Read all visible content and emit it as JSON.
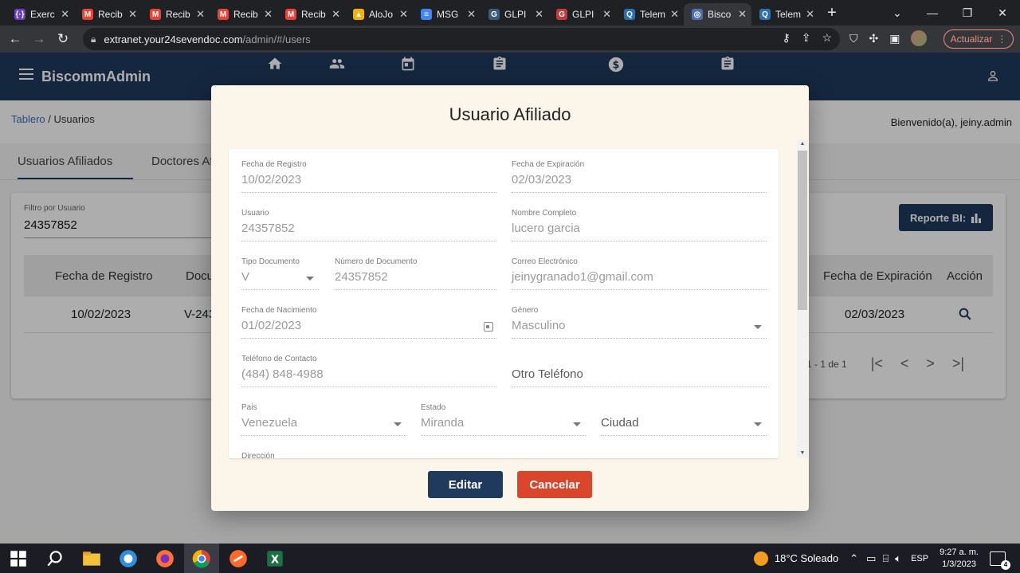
{
  "browser": {
    "tabs": [
      {
        "label": "Exerc",
        "icon": "dev-icon",
        "color": "#6a3cc4",
        "glyph": "{·}"
      },
      {
        "label": "Recib",
        "icon": "gmail-icon",
        "color": "#ea4335",
        "glyph": "M"
      },
      {
        "label": "Recib",
        "icon": "gmail-icon",
        "color": "#ea4335",
        "glyph": "M"
      },
      {
        "label": "Recib",
        "icon": "gmail-icon",
        "color": "#ea4335",
        "glyph": "M"
      },
      {
        "label": "Recib",
        "icon": "gmail-icon",
        "color": "#ea4335",
        "glyph": "M"
      },
      {
        "label": "AloJo",
        "icon": "drive-icon",
        "color": "#f4b400",
        "glyph": "▲"
      },
      {
        "label": "MSG",
        "icon": "docs-icon",
        "color": "#4285f4",
        "glyph": "≡"
      },
      {
        "label": "GLPI",
        "icon": "glpi-icon",
        "color": "#3a5a7a",
        "glyph": "G"
      },
      {
        "label": "GLPI",
        "icon": "glpi-icon",
        "color": "#c23a3a",
        "glyph": "G"
      },
      {
        "label": "Telem",
        "icon": "teleconsult-icon",
        "color": "#2b6fb3",
        "glyph": "Q"
      },
      {
        "label": "Bisco",
        "icon": "biscomm-icon",
        "color": "#4a6fb3",
        "glyph": "◎",
        "active": true
      },
      {
        "label": "Telem",
        "icon": "teleconsult-icon",
        "color": "#2b6fb3",
        "glyph": "Q"
      }
    ],
    "url_host": "extranet.your24sevendoc.com",
    "url_path": "/admin/#/users",
    "update_label": "Actualizar"
  },
  "app": {
    "brand": "BiscommAdmin",
    "breadcrumb": {
      "link": "Tablero",
      "current": " / Usuarios"
    },
    "welcome": "Bienvenido(a), jeiny.admin",
    "tabs": [
      "Usuarios Afiliados",
      "Doctores Af"
    ],
    "filter": {
      "label": "Filtro por Usuario",
      "value": "24357852"
    },
    "report_label": "Reporte BI:",
    "table": {
      "headers": [
        "Fecha de Registro",
        "Docu",
        "Fecha de Expiración",
        "Acción"
      ],
      "row": {
        "registro": "10/02/2023",
        "documento": "V-243",
        "expiracion": "02/03/2023"
      },
      "pager": "1 - 1 de 1"
    }
  },
  "modal": {
    "title": "Usuario Afiliado",
    "fields": {
      "fecha_registro": {
        "label": "Fecha de Registro",
        "value": "10/02/2023"
      },
      "fecha_expiracion": {
        "label": "Fecha de Expiración",
        "value": "02/03/2023"
      },
      "usuario": {
        "label": "Usuario",
        "value": "24357852"
      },
      "nombre": {
        "label": "Nombre Completo",
        "value": "lucero garcia"
      },
      "tipo_doc": {
        "label": "Tipo Documento",
        "value": "V"
      },
      "num_doc": {
        "label": "Número de Documento",
        "value": "24357852"
      },
      "correo": {
        "label": "Correo Electrónico",
        "value": "jeinygranado1@gmail.com"
      },
      "nacimiento": {
        "label": "Fecha de Nacimiento",
        "value": "01/02/2023"
      },
      "genero": {
        "label": "Género",
        "value": "Masculino"
      },
      "telefono": {
        "label": "Teléfono de Contacto",
        "value": "(484) 848-4988"
      },
      "otro_tel": {
        "label": "",
        "value": "Otro Teléfono"
      },
      "pais": {
        "label": "Pais",
        "value": "Venezuela"
      },
      "estado": {
        "label": "Estado",
        "value": "Miranda"
      },
      "ciudad": {
        "label": "",
        "value": "Ciudad"
      },
      "direccion": {
        "label": "Dirección",
        "value": ""
      }
    },
    "edit_label": "Editar",
    "cancel_label": "Cancelar"
  },
  "taskbar": {
    "weather": "18°C  Soleado",
    "lang": "ESP",
    "time": "9:27 a. m.",
    "date": "1/3/2023",
    "notifications": "4"
  },
  "colors": {
    "primary": "#1f3a5c",
    "cancel": "#d9462c",
    "modal_bg": "#fcf5ea"
  }
}
